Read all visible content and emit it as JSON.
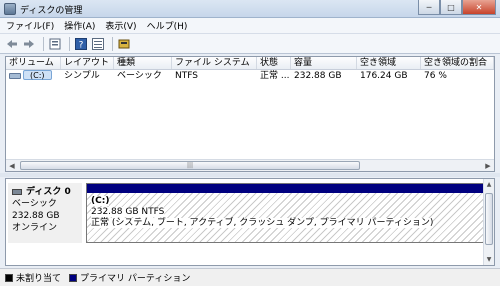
{
  "window": {
    "title": "ディスクの管理",
    "min": "─",
    "max": "□",
    "close": "✕"
  },
  "menu": [
    "ファイル(F)",
    "操作(A)",
    "表示(V)",
    "ヘルプ(H)"
  ],
  "columns": [
    "ボリューム",
    "レイアウト",
    "種類",
    "ファイル システム",
    "状態",
    "容量",
    "空き領域",
    "空き領域の割合"
  ],
  "volumes": [
    {
      "name": "(C:)",
      "layout": "シンプル",
      "type": "ベーシック",
      "fs": "NTFS",
      "status": "正常 ...",
      "capacity": "232.88 GB",
      "free": "176.24 GB",
      "free_pct": "76 %"
    }
  ],
  "disk": {
    "title": "ディスク 0",
    "type": "ベーシック",
    "size": "232.88 GB",
    "state": "オンライン"
  },
  "partition": {
    "name": "(C:)",
    "size_fs": "232.88 GB NTFS",
    "status": "正常 (システム, ブート, アクティブ, クラッシュ ダンプ, プライマリ パーティション)"
  },
  "legend": [
    {
      "label": "未割り当て",
      "color": "#000000"
    },
    {
      "label": "プライマリ パーティション",
      "color": "#00007f"
    }
  ],
  "icons": {
    "back": "back-arrow-icon",
    "forward": "forward-arrow-icon",
    "help": "help-icon"
  },
  "colors": {
    "primary_partition": "#00007f",
    "unallocated": "#000000"
  }
}
